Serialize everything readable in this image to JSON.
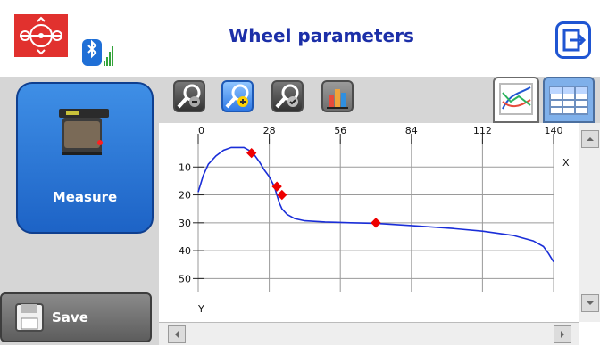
{
  "header": {
    "title": "Wheel parameters",
    "logo_icon": "wheel-logo-icon",
    "bluetooth_icon": "bluetooth-icon",
    "signal_icon": "signal-strength-icon",
    "exit_icon": "exit-icon",
    "accent": "#1f55d2",
    "logo_color": "#e1312e"
  },
  "sidebar": {
    "measure_label": "Measure",
    "save_label": "Save",
    "measure_icon": "gauge-device-icon",
    "save_icon": "floppy-disk-icon"
  },
  "toolbar": {
    "buttons": [
      {
        "name": "zoom-out",
        "icon": "zoom-out-icon"
      },
      {
        "name": "zoom-in",
        "icon": "zoom-in-icon",
        "selected": true
      },
      {
        "name": "zoom-reset",
        "icon": "zoom-check-icon"
      },
      {
        "name": "bar-chart",
        "icon": "bar-chart-icon"
      }
    ],
    "tabs": [
      {
        "name": "graph-view",
        "icon": "line-graph-icon",
        "active": true
      },
      {
        "name": "table-view",
        "icon": "table-icon",
        "active": false
      }
    ]
  },
  "chart_data": {
    "type": "line",
    "x_ticks": [
      "0",
      "28",
      "56",
      "84",
      "112",
      "140"
    ],
    "y_ticks": [
      "10",
      "20",
      "30",
      "40",
      "50"
    ],
    "x_axis_label": "X",
    "y_axis_label": "Y",
    "xlim": [
      0,
      140
    ],
    "ylim": [
      0,
      55
    ],
    "grid": true,
    "line_color": "#1a2ed8",
    "marker_color": "#ee0000",
    "series": [
      {
        "points": [
          [
            0,
            19
          ],
          [
            2,
            13
          ],
          [
            4,
            9
          ],
          [
            7,
            6
          ],
          [
            10,
            4
          ],
          [
            13,
            3
          ],
          [
            16,
            3
          ],
          [
            18,
            3
          ],
          [
            20,
            4
          ],
          [
            22,
            5.5
          ],
          [
            24,
            8
          ],
          [
            26,
            11
          ],
          [
            28,
            13.5
          ],
          [
            30,
            17
          ],
          [
            31,
            20
          ],
          [
            32,
            23
          ],
          [
            33,
            25
          ],
          [
            35,
            27
          ],
          [
            38,
            28.5
          ],
          [
            42,
            29.3
          ],
          [
            50,
            29.7
          ],
          [
            60,
            30
          ],
          [
            70,
            30.2
          ],
          [
            84,
            31
          ],
          [
            100,
            32
          ],
          [
            112,
            33
          ],
          [
            124,
            34.5
          ],
          [
            132,
            36.5
          ],
          [
            136,
            38.5
          ],
          [
            138,
            41
          ],
          [
            140,
            44
          ]
        ]
      }
    ],
    "markers": [
      [
        21,
        5
      ],
      [
        31,
        17
      ],
      [
        33,
        20
      ],
      [
        70,
        30
      ]
    ]
  }
}
